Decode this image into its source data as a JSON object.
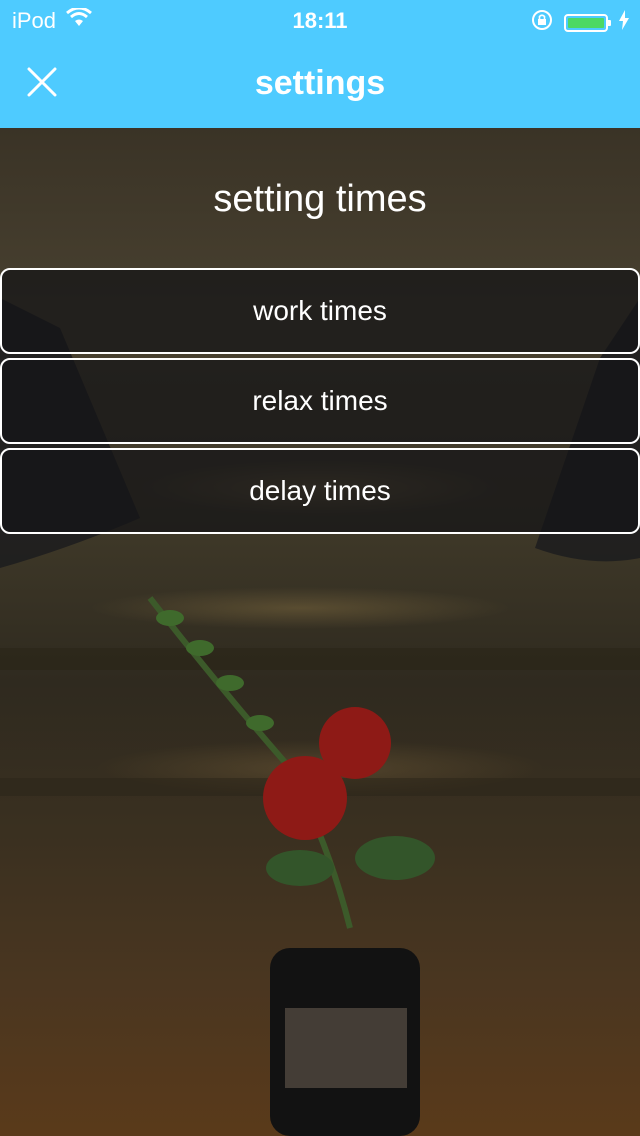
{
  "status_bar": {
    "carrier": "iPod",
    "time": "18:11",
    "battery_level": 1.0,
    "battery_color": "#4cd964",
    "icons": [
      "wifi-icon",
      "rotation-lock-icon",
      "battery-icon",
      "charging-bolt-icon"
    ]
  },
  "nav_bar": {
    "title": "settings",
    "close_icon": "close-icon",
    "background_color": "#4ecbff"
  },
  "content": {
    "section_title": "setting times",
    "options": [
      {
        "label": "work times"
      },
      {
        "label": "relax times"
      },
      {
        "label": "delay times"
      }
    ]
  }
}
